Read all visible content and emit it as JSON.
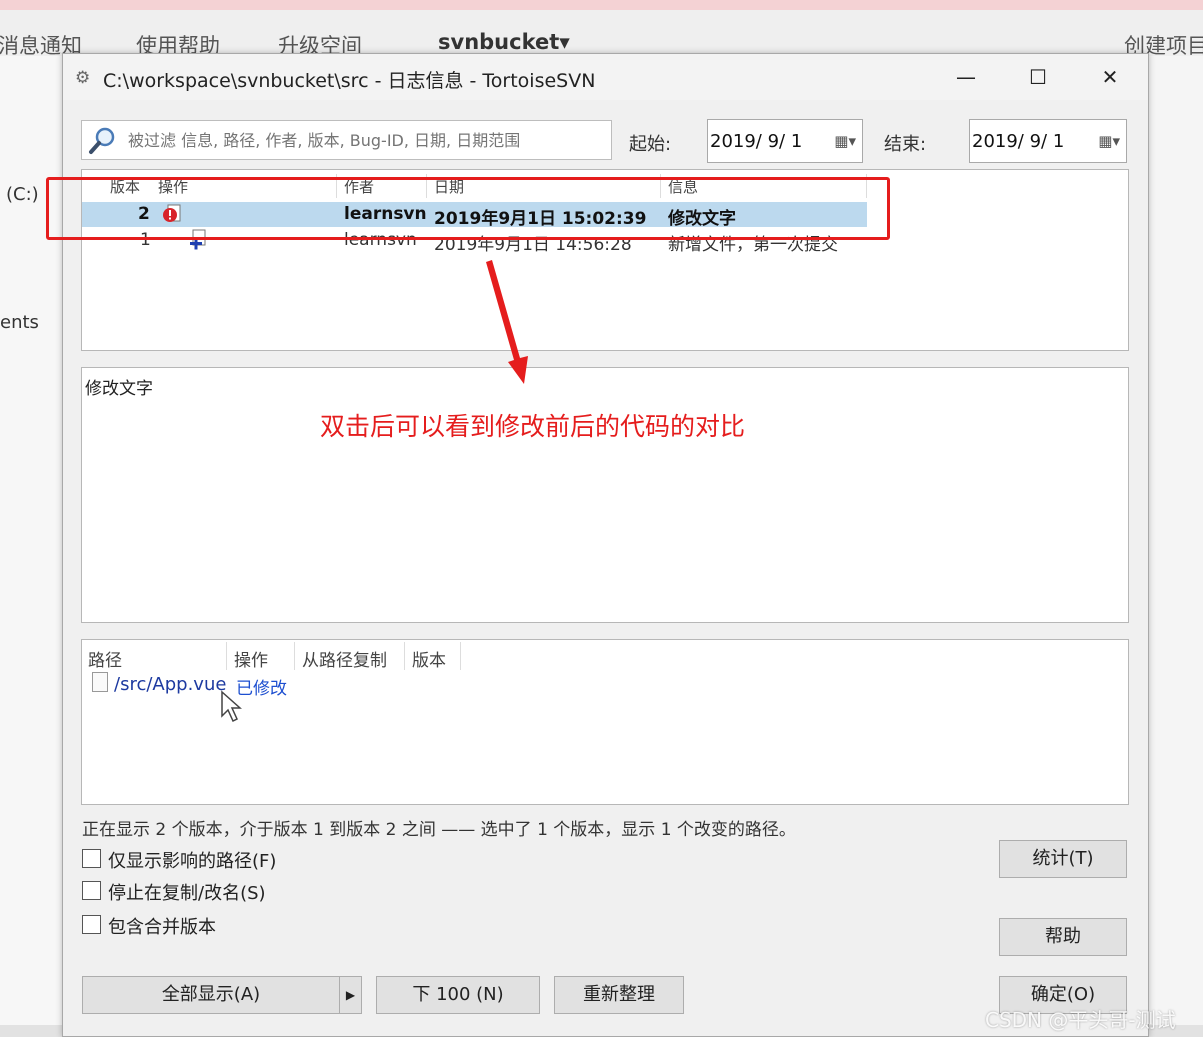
{
  "background": {
    "menu": [
      "消息通知",
      "使用帮助",
      "升级空间",
      "svnbucket▾",
      "创建项目"
    ],
    "left_labels": [
      "(C:)",
      "ents"
    ]
  },
  "window": {
    "title": "C:\\workspace\\svnbucket\\src - 日志信息 - TortoiseSVN",
    "controls": {
      "minimize": "—",
      "maximize": "☐",
      "close": "✕"
    }
  },
  "filter": {
    "placeholder": "被过滤 信息, 路径, 作者, 版本, Bug-ID, 日期, 日期范围",
    "from_label": "起始:",
    "from_date": "2019/ 9/ 1",
    "to_label": "结束:",
    "to_date": "2019/ 9/ 1"
  },
  "log_table": {
    "columns": [
      "版本",
      "操作",
      "作者",
      "日期",
      "信息"
    ],
    "rows": [
      {
        "revision": "2",
        "author": "learnsvn",
        "date": "2019年9月1日 15:02:39",
        "message": "修改文字",
        "selected": true
      },
      {
        "revision": "1",
        "author": "learnsvn",
        "date": "2019年9月1日 14:56:28",
        "message": "新增文件，第一次提交",
        "selected": false
      }
    ]
  },
  "message_panel": {
    "text": "修改文字"
  },
  "annotation": "双击后可以看到修改前后的代码的对比",
  "paths_table": {
    "columns": [
      "路径",
      "操作",
      "从路径复制",
      "版本"
    ],
    "rows": [
      {
        "path": "/src/App.vue",
        "action": "已修改"
      }
    ]
  },
  "status_text": "正在显示 2 个版本，介于版本 1 到版本 2 之间 —— 选中了 1 个版本，显示 1 个改变的路径。",
  "checkboxes": [
    "仅显示影响的路径(F)",
    "停止在复制/改名(S)",
    "包含合并版本"
  ],
  "buttons": {
    "show_all": "全部显示(A)",
    "next_100": "下 100 (N)",
    "refresh": "重新整理",
    "stats": "统计(T)",
    "help": "帮助",
    "ok": "确定(O)"
  },
  "watermark": "CSDN @平头哥-测试",
  "colors": {
    "annotation_red": "#e51d1d",
    "selection_blue": "#bcd9ee"
  }
}
